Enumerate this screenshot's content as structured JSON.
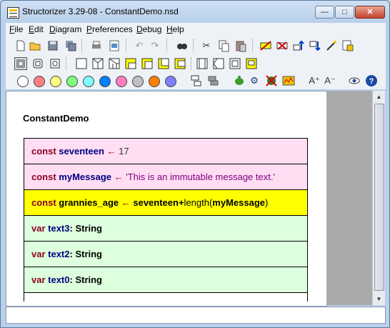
{
  "window": {
    "title": "Structorizer 3.29-08 - ConstantDemo.nsd",
    "buttons": {
      "minimize": "—",
      "maximize": "□",
      "close": "✕"
    }
  },
  "menu": [
    {
      "label": "File"
    },
    {
      "label": "Edit"
    },
    {
      "label": "Diagram"
    },
    {
      "label": "Preferences"
    },
    {
      "label": "Debug"
    },
    {
      "label": "Help"
    }
  ],
  "toolbar_row1_icons": [
    "new-file-icon",
    "open-folder-icon",
    "save-icon",
    "save-all-icon",
    "print-icon",
    "export-picture-icon",
    "undo-icon",
    "redo-icon",
    "find-icon",
    "cut-icon",
    "copy-icon",
    "paste-icon",
    "disable-icon",
    "delete-icon",
    "move-up-icon",
    "move-down-icon",
    "transmute-icon",
    "collapse-icon"
  ],
  "toolbar_row2_icons": [
    "box-view-icon",
    "box-rounded-icon",
    "box-nested-icon",
    "add-instruction-icon",
    "add-alternative-icon",
    "add-case-icon",
    "add-for-icon",
    "add-while-icon",
    "add-repeat-icon",
    "add-endless-icon",
    "add-call-icon",
    "add-jump-icon",
    "add-parallel-icon",
    "add-try-icon"
  ],
  "toolbar_row3_colors": [
    "#ffffff",
    "#ff8080",
    "#ffff80",
    "#80ff80",
    "#80ffff",
    "#0080ff",
    "#ff80c0",
    "#c0c0c0",
    "#ff8000",
    "#8080ff"
  ],
  "toolbar_row3_icons": [
    "break-icon",
    "join-icon",
    "analyser-icon",
    "turtle-icon",
    "settings-gear-icon",
    "no-debug-icon",
    "chart-icon",
    "font-up-icon",
    "font-down-icon",
    "eye-icon",
    "help-icon"
  ],
  "diagram": {
    "title": "ConstantDemo",
    "rows": [
      {
        "bg": "#ffddf3",
        "parts": [
          [
            "kw",
            "const "
          ],
          [
            "var",
            "seventeen "
          ],
          [
            "arrow",
            "← "
          ],
          [
            "num",
            "17"
          ]
        ]
      },
      {
        "bg": "#ffddf3",
        "parts": [
          [
            "kw",
            "const "
          ],
          [
            "var",
            "myMessage "
          ],
          [
            "arrow",
            "← "
          ],
          [
            "str",
            "'This is an immutable message text.'"
          ]
        ]
      },
      {
        "bg": "#ffff00",
        "parts": [
          [
            "kw",
            "const "
          ],
          [
            "boldblack",
            "grannies_age "
          ],
          [
            "arrow",
            "← "
          ],
          [
            "boldblack",
            "seventeen+"
          ],
          [
            "plain",
            "length("
          ],
          [
            "boldblack",
            "myMessage"
          ],
          [
            "plain",
            ")"
          ]
        ]
      },
      {
        "bg": "#ddffdd",
        "parts": [
          [
            "kw",
            "var "
          ],
          [
            "var",
            "text3"
          ],
          [
            "boldblack",
            ": String"
          ]
        ]
      },
      {
        "bg": "#ddffdd",
        "parts": [
          [
            "kw",
            "var "
          ],
          [
            "var",
            "text2"
          ],
          [
            "boldblack",
            ": String"
          ]
        ]
      },
      {
        "bg": "#ddffdd",
        "parts": [
          [
            "kw",
            "var "
          ],
          [
            "var",
            "text0"
          ],
          [
            "boldblack",
            ": String"
          ]
        ]
      },
      {
        "bg": "#ffffff",
        "parts": []
      }
    ]
  }
}
